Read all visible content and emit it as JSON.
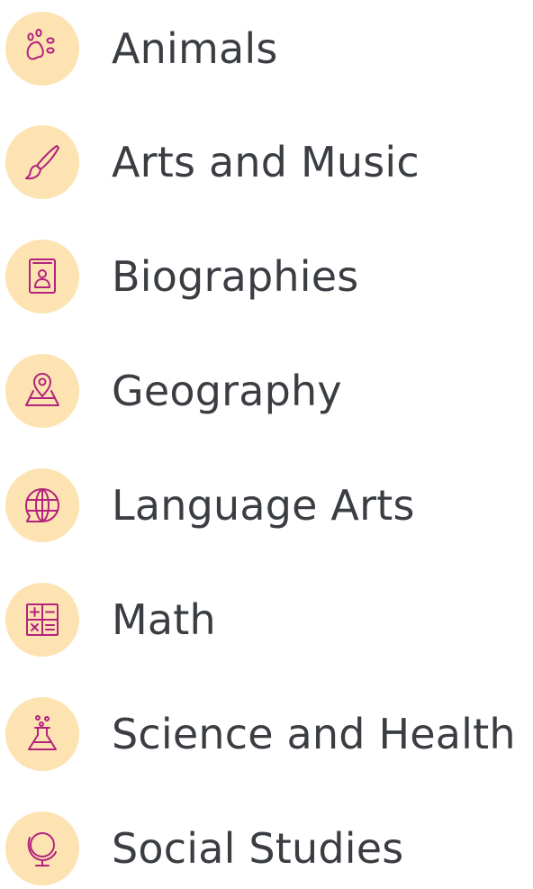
{
  "colors": {
    "icon_background": "#FCE3B1",
    "icon_stroke": "#B3237E",
    "label_text": "#3A3D42"
  },
  "categories": [
    {
      "label": "Animals",
      "icon": "paw-icon"
    },
    {
      "label": "Arts and Music",
      "icon": "paintbrush-icon"
    },
    {
      "label": "Biographies",
      "icon": "person-book-icon"
    },
    {
      "label": "Geography",
      "icon": "map-pin-icon"
    },
    {
      "label": "Language Arts",
      "icon": "globe-speech-icon"
    },
    {
      "label": "Math",
      "icon": "calculator-icon"
    },
    {
      "label": "Science and Health",
      "icon": "flask-icon"
    },
    {
      "label": "Social Studies",
      "icon": "desk-globe-icon"
    }
  ]
}
